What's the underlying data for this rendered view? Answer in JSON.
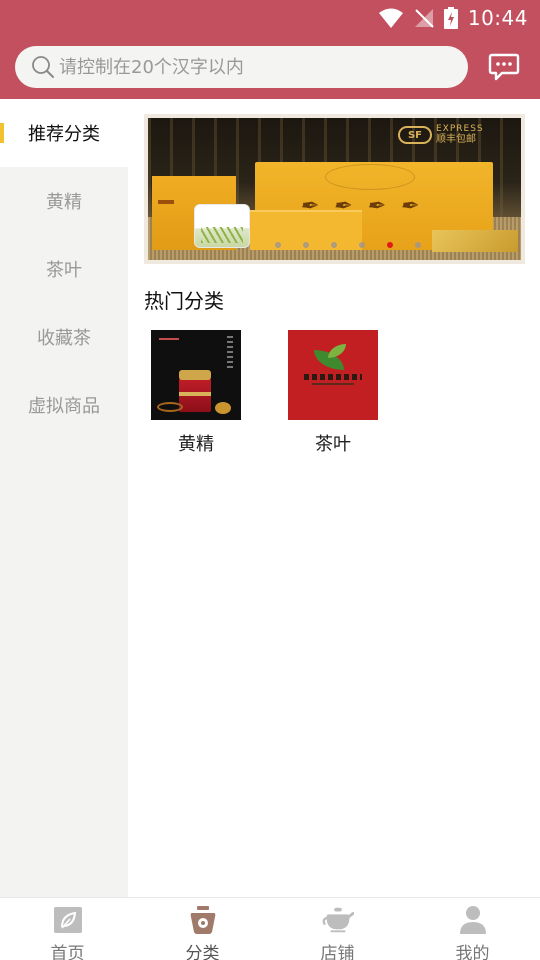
{
  "status_bar": {
    "time": "10:44",
    "icons": [
      "wifi-icon",
      "no-signal-icon",
      "battery-charging-icon"
    ]
  },
  "header": {
    "search_placeholder": "请控制在20个汉字以内",
    "search_icon": "search-icon",
    "message_icon": "message-icon"
  },
  "sidebar": {
    "items": [
      {
        "label": "推荐分类",
        "active": true
      },
      {
        "label": "黄精",
        "active": false
      },
      {
        "label": "茶叶",
        "active": false
      },
      {
        "label": "收藏茶",
        "active": false
      },
      {
        "label": "虚拟商品",
        "active": false
      }
    ]
  },
  "banner": {
    "badge_logo": "SF",
    "badge_text_en": "EXPRESS",
    "badge_text_cn": "顺丰包邮",
    "slide_count": 6,
    "active_slide": 4
  },
  "hot": {
    "title": "热门分类",
    "items": [
      {
        "label": "黄精"
      },
      {
        "label": "茶叶"
      }
    ]
  },
  "bottom_nav": {
    "items": [
      {
        "label": "首页",
        "icon": "home-leaf-icon",
        "active": false
      },
      {
        "label": "分类",
        "icon": "category-icon",
        "active": true
      },
      {
        "label": "店铺",
        "icon": "teapot-icon",
        "active": false
      },
      {
        "label": "我的",
        "icon": "user-icon",
        "active": false
      }
    ]
  },
  "colors": {
    "primary": "#c2505f",
    "sidebar_bg": "#f3f3f1",
    "active_indicator": "#f2c12e",
    "muted_text": "#999999"
  }
}
